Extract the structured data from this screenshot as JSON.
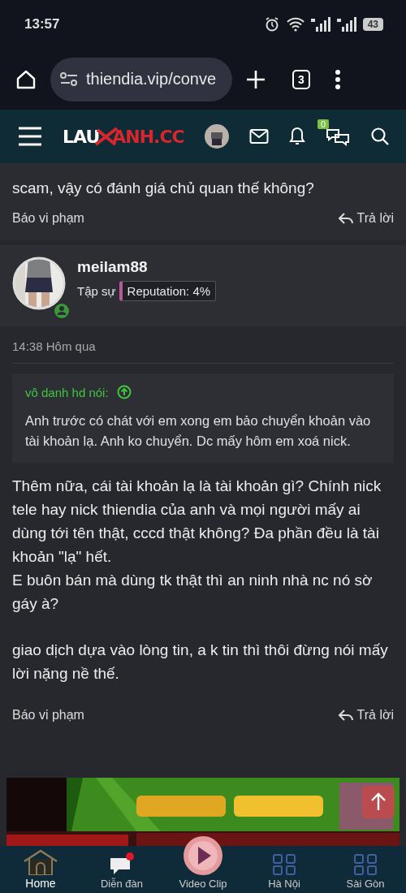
{
  "status_bar": {
    "time": "13:57",
    "battery": "43"
  },
  "browser": {
    "url": "thiendia.vip/conve",
    "tab_count": "3"
  },
  "site_header": {
    "logo_left": "LAU",
    "logo_right": "ANH.CC",
    "conversations_badge": "0"
  },
  "previous_post": {
    "tail": "scam, vậy có đánh giá chủ quan thế không?",
    "report": "Báo vi phạm",
    "reply": "Trả lời"
  },
  "post": {
    "author": "meilam88",
    "online": true,
    "rank": "Tập sự",
    "reputation": "Reputation: 4%",
    "time": "14:38 Hôm qua",
    "quote": {
      "author": "vô danh hd nói:",
      "text": "Anh trước có chát với em xong em bảo chuyển khoản vào tài khoản lạ. Anh ko chuyển. Dc mấy hôm em xoá nick."
    },
    "paragraphs": [
      "Thêm nữa, cái tài khoản lạ là tài khoản gì? Chính nick tele hay nick thiendia của anh và mọi người mấy ai dùng tới tên thật, cccd thật không? Đa phần đều là tài khoản \"lạ\" hết.\nE buôn bán mà dùng tk thật thì an ninh nhà nc nó sờ gáy à?",
      "giao dịch dựa vào lòng tin, a k tin thì thôi đừng nói mấy lời nặng nề thế."
    ],
    "report": "Báo vi phạm",
    "reply": "Trả lời"
  },
  "bottom_nav": [
    {
      "label": "Home",
      "kind": "home",
      "selected": true
    },
    {
      "label": "Diễn đàn",
      "kind": "forum",
      "selected": false
    },
    {
      "label": "Video Clip",
      "kind": "video",
      "selected": false
    },
    {
      "label": "Hà Nội",
      "kind": "grid",
      "selected": false
    },
    {
      "label": "Sài Gòn",
      "kind": "grid",
      "selected": false
    }
  ]
}
